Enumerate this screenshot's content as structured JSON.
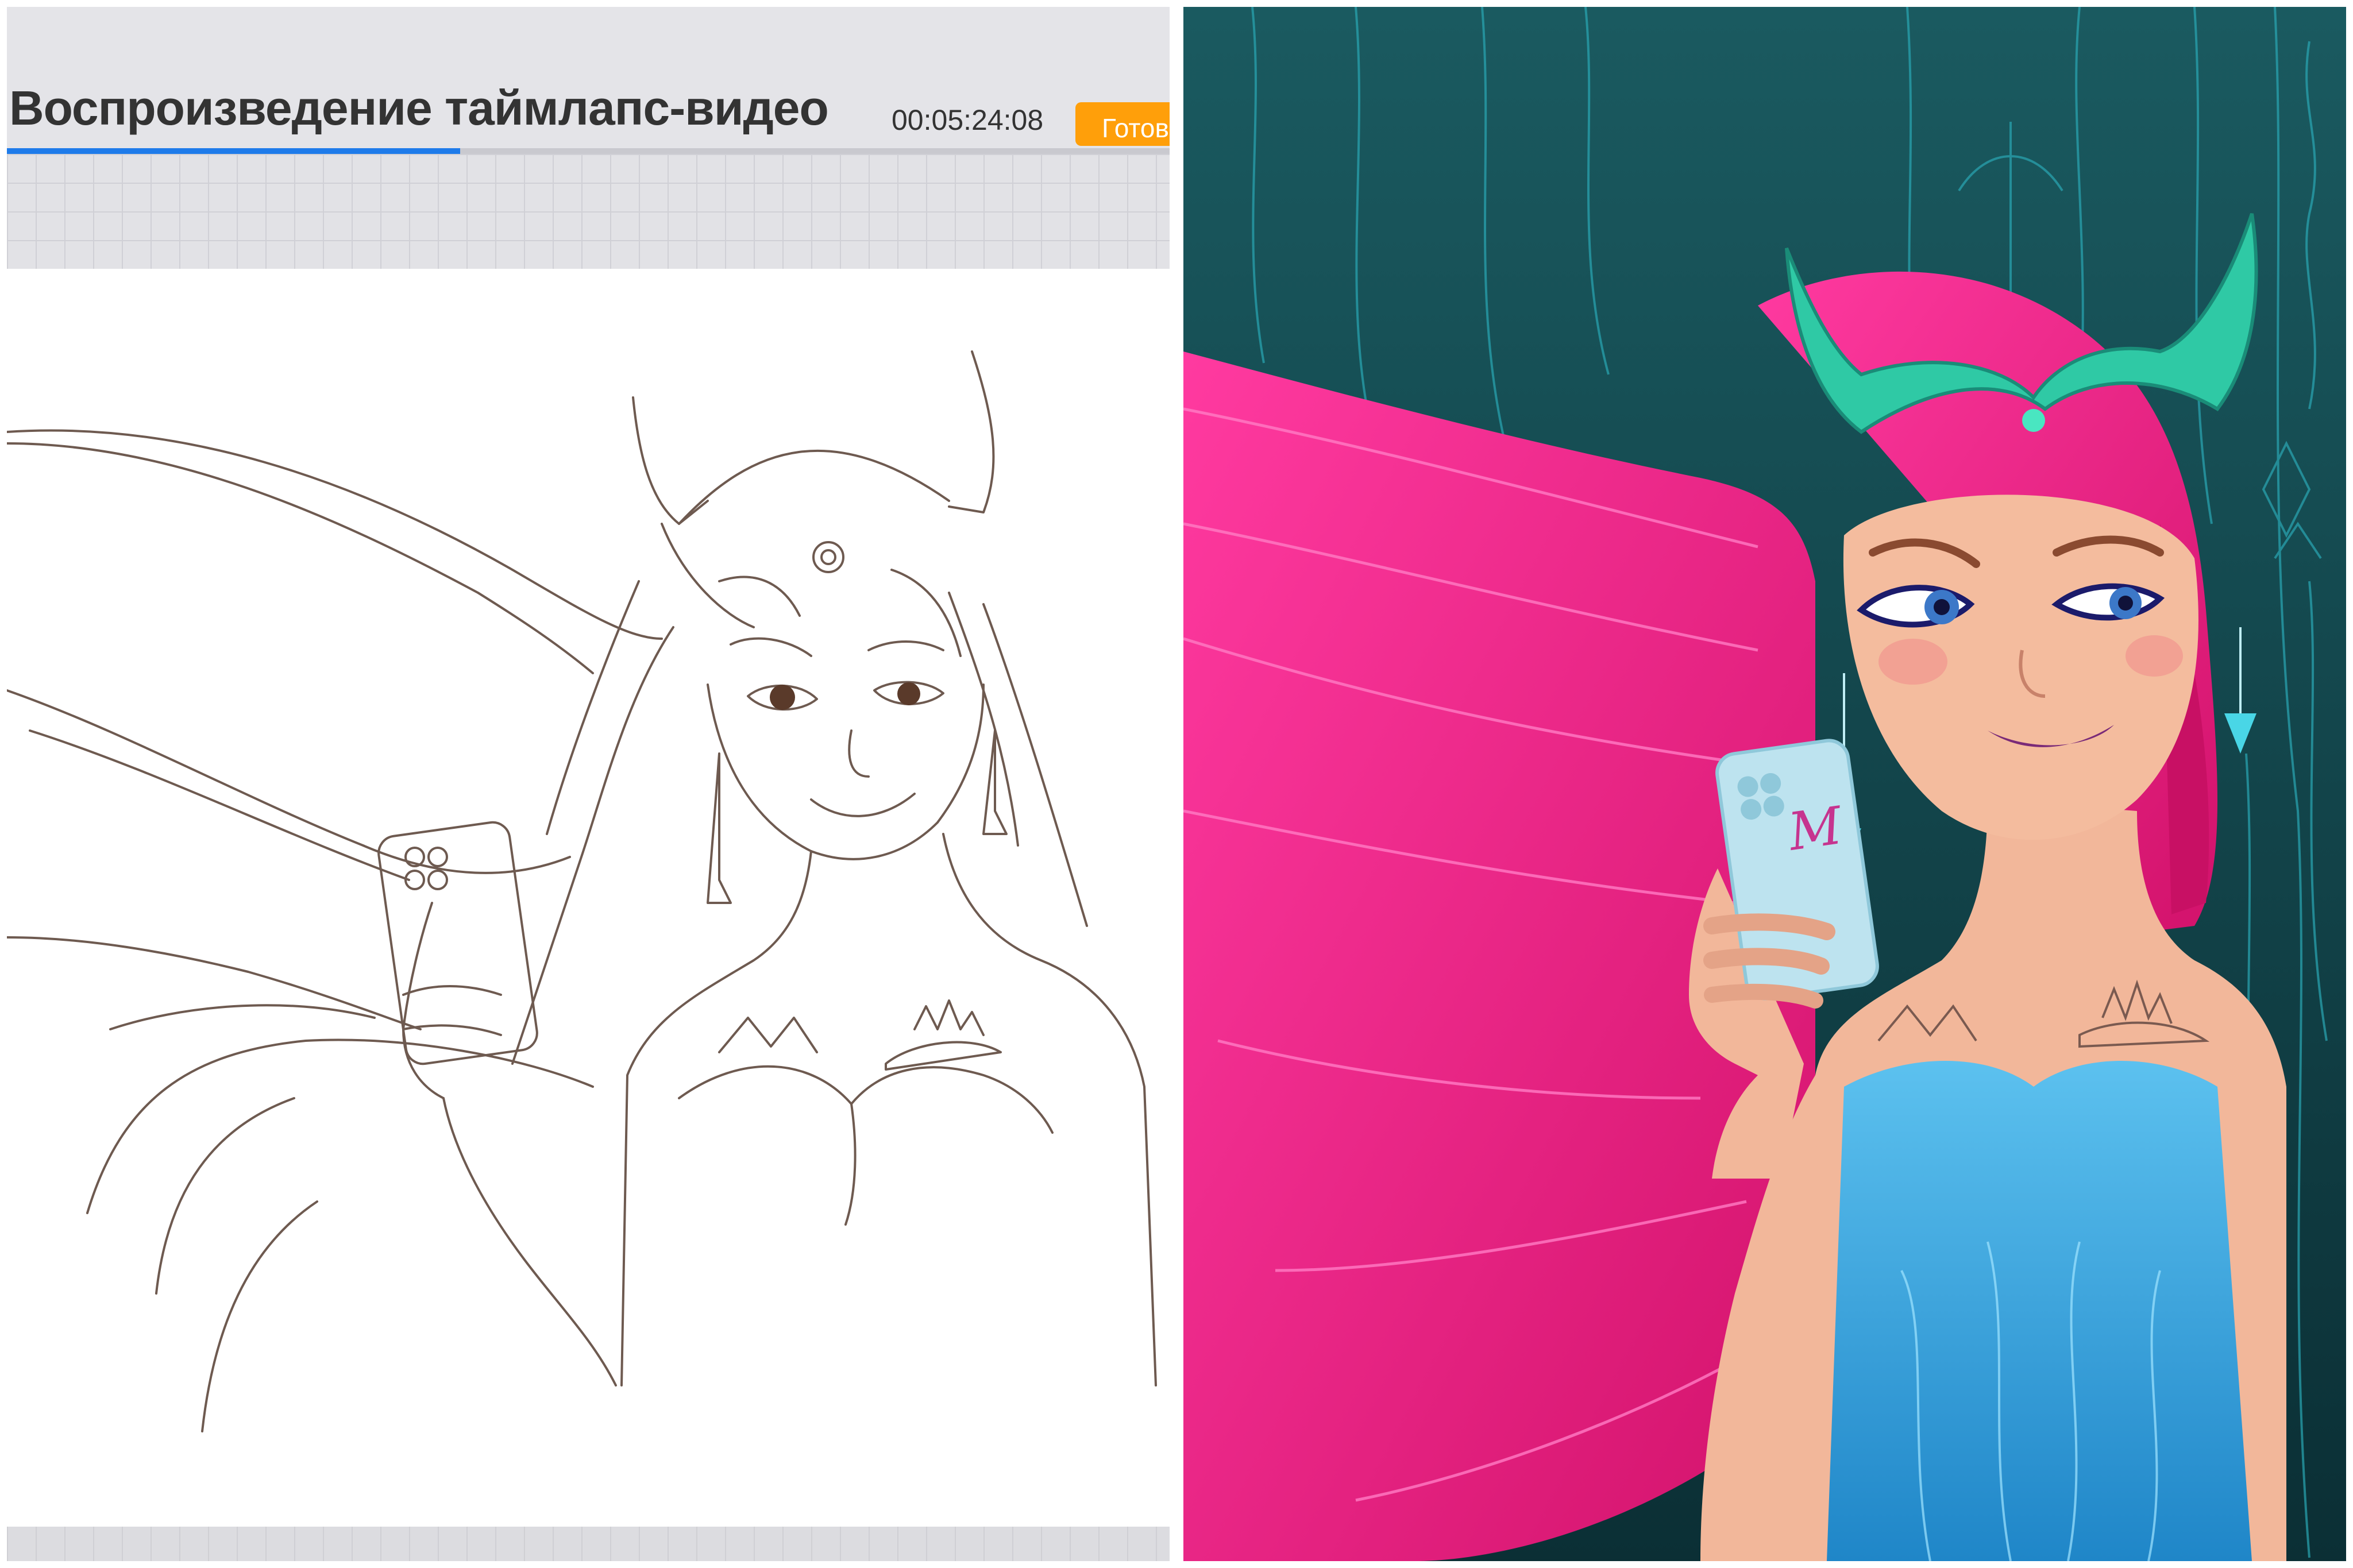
{
  "timelapse": {
    "title": "Воспроизведение таймлапс-видео",
    "timecode": "00:05:24:08",
    "done_label": "Готово",
    "progress": 0.39
  },
  "colors": {
    "top_bar": "#e4e4e8",
    "accent_orange": "#ff9f0a",
    "progress_blue": "#1e7bea",
    "background_teal": "#0f3b40",
    "hair_pink": "#e8197a",
    "dress_blue": "#3aa8e0",
    "crown_green": "#2fc9a5",
    "skin": "#f2b79a"
  },
  "illustration": {
    "phone_monogram": "M"
  }
}
